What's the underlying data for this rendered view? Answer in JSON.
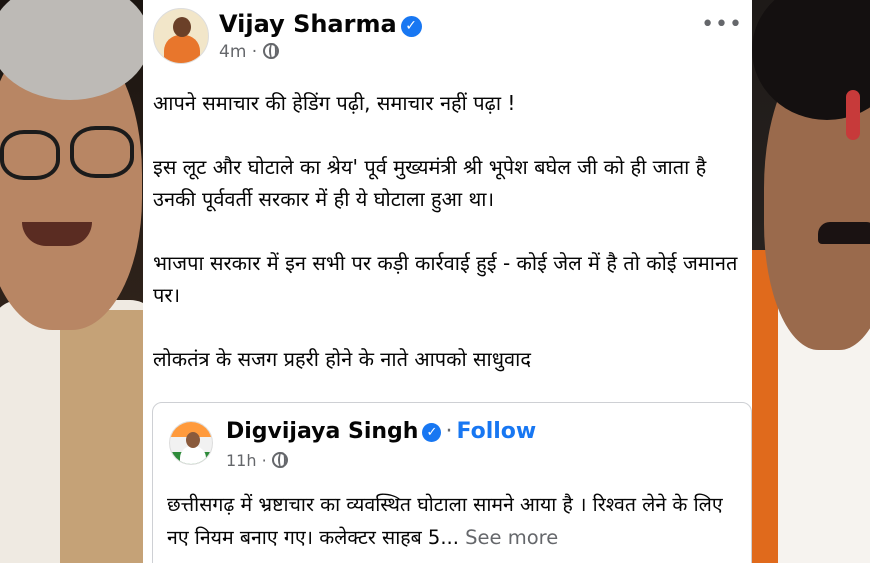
{
  "post": {
    "author": "Vijay Sharma",
    "time": "4m",
    "more_label": "•••",
    "paragraphs": [
      "आपने समाचार की हेडिंग पढ़ी, समाचार नहीं पढ़ा !",
      "इस लूट और घोटाले का श्रेय' पूर्व मुख्यमंत्री श्री भूपेश बघेल जी को ही जाता है उनकी पूर्ववर्ती सरकार में ही ये घोटाला हुआ था।",
      "भाजपा सरकार में इन सभी पर कड़ी कार्रवाई हुई - कोई जेल में है तो कोई जमानत पर।",
      "लोकतंत्र के सजग प्रहरी होने के नाते आपको साधुवाद"
    ]
  },
  "shared_post": {
    "author": "Digvijaya Singh",
    "separator": "·",
    "follow_label": "Follow",
    "time": "11h",
    "text": "छत्तीसगढ़ में भ्रष्टाचार का व्यवस्थित घोटाला सामने आया है । रिश्वत लेने के लिए नए नियम बनाए गए। कलेक्टर साहब 5...",
    "see_more_label": "See more"
  },
  "icons": {
    "verified": "verified-badge-icon",
    "privacy": "globe-icon",
    "more": "more-options-icon"
  },
  "colors": {
    "link_blue": "#1877f2",
    "meta_gray": "#65676b",
    "text": "#050505"
  }
}
